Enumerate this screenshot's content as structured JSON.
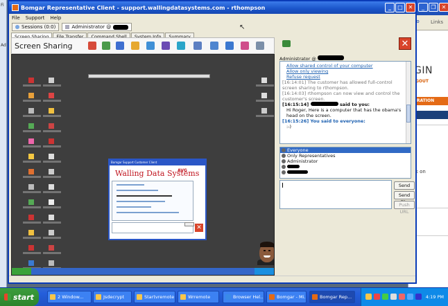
{
  "app": {
    "title": "Bomgar Representative Client - support.wallingdatasystems.com - rthompson",
    "menu": [
      "File",
      "Support",
      "Help"
    ],
    "sessions_label": "Sessions (0:0)",
    "session_tab_label": "Administrator @",
    "tabs": [
      "Screen Sharing",
      "File Transfer",
      "Command Shell",
      "System Info",
      "Summary"
    ],
    "screen_sharing_title": "Screen Sharing"
  },
  "chat": {
    "header_user": "Administrator @",
    "log": {
      "link1": "Allow shared control of your computer",
      "link2": "Allow only viewing",
      "link3": "Refuse request",
      "msg1": "[16:14:01] The customer has allowed full-control screen sharing to rthompson.",
      "msg2": "[16:14:03] rthompson can now view and control the customer's screen.",
      "msg3_time": "[16:15:14]",
      "msg3_suffix": "said to you:",
      "msg3_body": "Hi Roger,  Here is a computer that has the obama's head on the screen.",
      "msg4_time": "[16:15:26]",
      "msg4_suffix": "You said to everyone:",
      "msg4_body": ":-)"
    },
    "recipients": [
      "Everyone",
      "Only Representatives",
      "Administrator"
    ],
    "buttons": {
      "send": "Send",
      "send_file": "Send File",
      "push_url": "Push URL"
    }
  },
  "customer_client": {
    "title": "Bomgar Support Customer Client",
    "logo": "Walling Data Systems",
    "vendor_logo": "AVG"
  },
  "background_browser": {
    "go": "Go",
    "links": "Links",
    "logo_fragment": "GIN",
    "logout_fragment": "GOUT",
    "orange_bar": "URATION",
    "body_fragment": "ck on"
  },
  "left_browser": {
    "fragments": [
      "Fi",
      "Ad"
    ]
  },
  "taskbar": {
    "start": "start",
    "buttons": [
      "2 Window...",
      "Jsdecrypt",
      "Startvremote",
      "Wrremote",
      "Browser Hel...",
      "Bomgar - Mi...",
      "Bomgar Rep..."
    ],
    "clock": "4:19 PM"
  }
}
